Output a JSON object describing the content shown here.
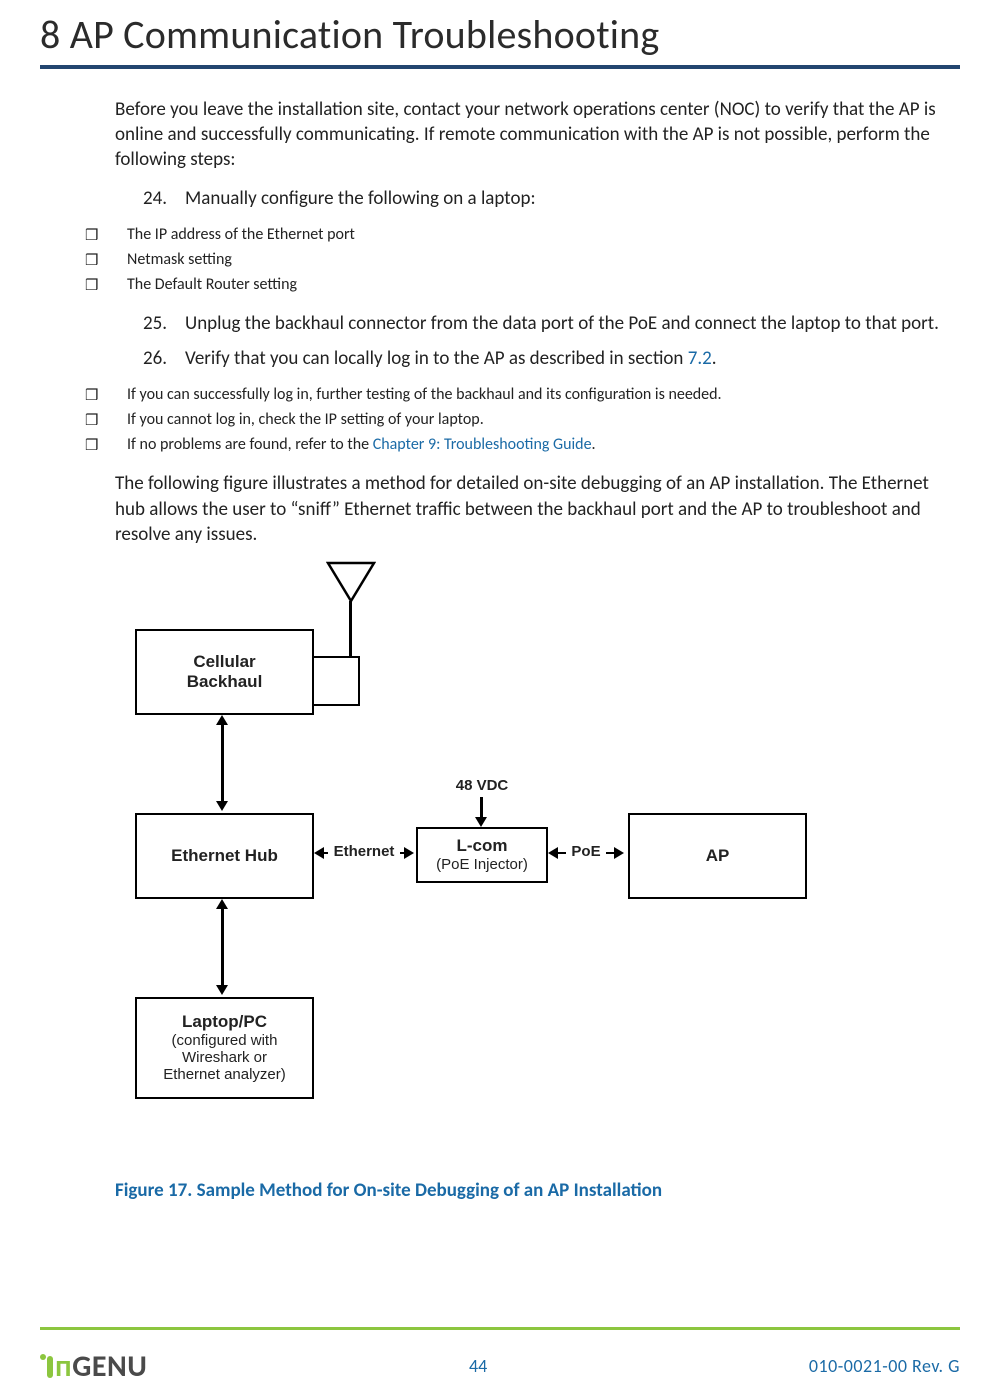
{
  "header": {
    "chapter_number": "8",
    "chapter_title": "AP Communication Troubleshooting"
  },
  "body": {
    "intro": "Before you leave the installation site, contact your network operations center (NOC) to verify that the AP is online and successfully communicating. If remote communication with the AP is not possible, perform the following steps:",
    "step24_num": "24.",
    "step24": "Manually configure the following on a laptop:",
    "check_a": "The IP address of the Ethernet port",
    "check_b": "Netmask setting",
    "check_c": "The Default Router setting",
    "step25_num": "25.",
    "step25": "Unplug the backhaul connector from the data port of the PoE and connect the laptop to that port.",
    "step26_num": "26.",
    "step26_pre": "Verify that you can locally log in to the AP as described in section ",
    "step26_link": "7.2",
    "step26_post": ".",
    "check_d": "If you can successfully log in, further testing of the backhaul and its configuration is needed.",
    "check_e": "If you cannot log in, check the IP setting of your laptop.",
    "check_f_pre": "If no problems are found, refer to the ",
    "check_f_link": "Chapter 9: Troubleshooting Guide",
    "check_f_post": ".",
    "para2": "The following figure illustrates a method for detailed on-site debugging of an AP installation. The Ethernet hub allows the user to “sniff” Ethernet traffic between the backhaul port and the AP to troubleshoot and resolve any issues."
  },
  "diagram": {
    "cellular_title": "Cellular",
    "cellular_sub": "Backhaul",
    "hub": "Ethernet Hub",
    "lcom_title": "L-com",
    "lcom_sub": "(PoE Injector)",
    "ap": "AP",
    "laptop_title": "Laptop/PC",
    "laptop_sub1": "(configured with",
    "laptop_sub2": "Wireshark or",
    "laptop_sub3": "Ethernet analyzer)",
    "label_48v": "48 VDC",
    "label_eth": "Ethernet",
    "label_poe": "PoE"
  },
  "figure_caption": "Figure 17. Sample Method for On-site Debugging of an AP Installation",
  "footer": {
    "logo_text": "GENU",
    "page_number": "44",
    "doc_id": "010-0021-00 Rev. G"
  }
}
